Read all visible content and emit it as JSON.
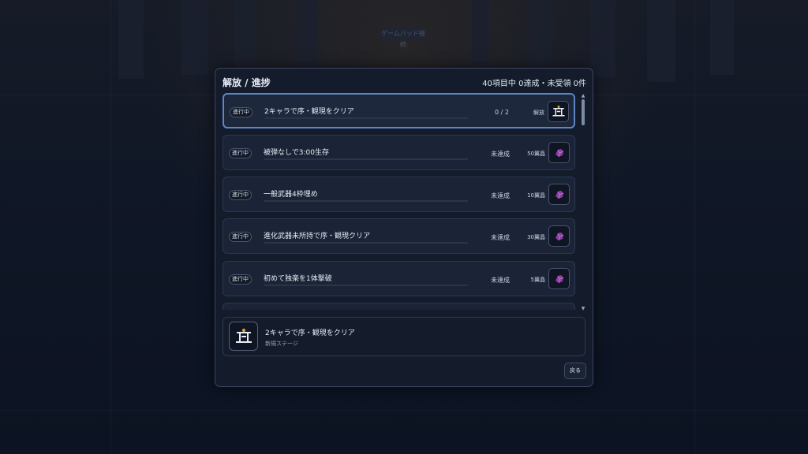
{
  "background": {
    "gamepad_label": "ゲームパッド接続"
  },
  "modal": {
    "title": "解放 / 進捗",
    "summary": "40項目中 0達成・未受領 0件",
    "back_label": "戻る"
  },
  "achievements": [
    {
      "badge": "進行中",
      "title": "2キャラで序・観現をクリア",
      "status": "0 / 2",
      "reward": "解放",
      "progress": 0,
      "reward_icon": "stage-gate-icon",
      "selected": true
    },
    {
      "badge": "進行中",
      "title": "被弾なしで3:00生存",
      "status": "未達成",
      "reward": "50翼晶",
      "progress": 0,
      "reward_icon": "crystal-icon",
      "selected": false
    },
    {
      "badge": "進行中",
      "title": "一般武器4枠埋め",
      "status": "未達成",
      "reward": "10翼晶",
      "progress": 0,
      "reward_icon": "crystal-icon",
      "selected": false
    },
    {
      "badge": "進行中",
      "title": "進化武器未所持で序・観現クリア",
      "status": "未達成",
      "reward": "30翼晶",
      "progress": 0,
      "reward_icon": "crystal-icon",
      "selected": false
    },
    {
      "badge": "進行中",
      "title": "初めて独楽を1体撃破",
      "status": "未達成",
      "reward": "5翼晶",
      "progress": 0,
      "reward_icon": "crystal-icon",
      "selected": false
    }
  ],
  "detail": {
    "title": "2キャラで序・観現をクリア",
    "subtitle": "新規ステージ",
    "icon": "stage-gate-icon"
  },
  "colors": {
    "accent": "#5d86c7",
    "panel": "#141c2c",
    "row": "#1b2436",
    "crystal": "#8a3fa0"
  }
}
